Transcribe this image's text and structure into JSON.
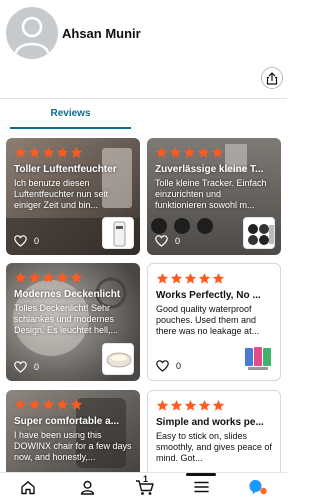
{
  "profile": {
    "name": "Ahsan Munir",
    "avatar_icon": "person-icon",
    "share_icon": "share-icon"
  },
  "tabs": [
    {
      "label": "Reviews",
      "active": true
    }
  ],
  "colors": {
    "star": "#ff5a1f",
    "accent": "#0f6e8c",
    "alexa": "#1a98ff",
    "alexa_dot": "#ff6a2b"
  },
  "reviews": [
    {
      "rating": 5,
      "title": "Toller Luftentfeuchter",
      "snippet": "Ich benutze diesen Luftentfeuchter nun seit einiger Zeit und bin...",
      "likes": "0",
      "photo": true,
      "product_icon": "dehumidifier-icon"
    },
    {
      "rating": 5,
      "title": "Zuverlässige kleine T...",
      "snippet": "Tolle kleine Tracker. Einfach einzurichten und funktionieren sowohl m...",
      "likes": "0",
      "photo": true,
      "product_icon": "tracker-set-icon"
    },
    {
      "rating": 5,
      "title": "Modernes Deckenlicht",
      "snippet": "Tolles Deckenlicht! Sehr schlankes und modernes Design. Es leuchtet hell,...",
      "likes": "0",
      "photo": true,
      "product_icon": "ceiling-light-icon"
    },
    {
      "rating": 5,
      "title": "Works Perfectly, No ...",
      "snippet": "Good quality waterproof pouches. Used them and there was no leakage at...",
      "likes": "0",
      "photo": false,
      "product_icon": "waterproof-pouches-icon"
    },
    {
      "rating": 5,
      "title": "Super comfortable a...",
      "snippet": "I have been using this DOWINX chair for a few days now, and honestly,...",
      "likes": "",
      "photo": true,
      "product_icon": "chair-icon"
    },
    {
      "rating": 5,
      "title": "Simple and works pe...",
      "snippet": "Easy to stick on, slides smoothly, and gives peace of mind. Got...",
      "likes": "",
      "photo": false,
      "product_icon": ""
    }
  ],
  "nav": [
    {
      "icon": "home-icon"
    },
    {
      "icon": "profile-icon"
    },
    {
      "icon": "cart-icon",
      "count": "1"
    },
    {
      "icon": "menu-icon"
    },
    {
      "icon": "alexa-icon"
    }
  ]
}
